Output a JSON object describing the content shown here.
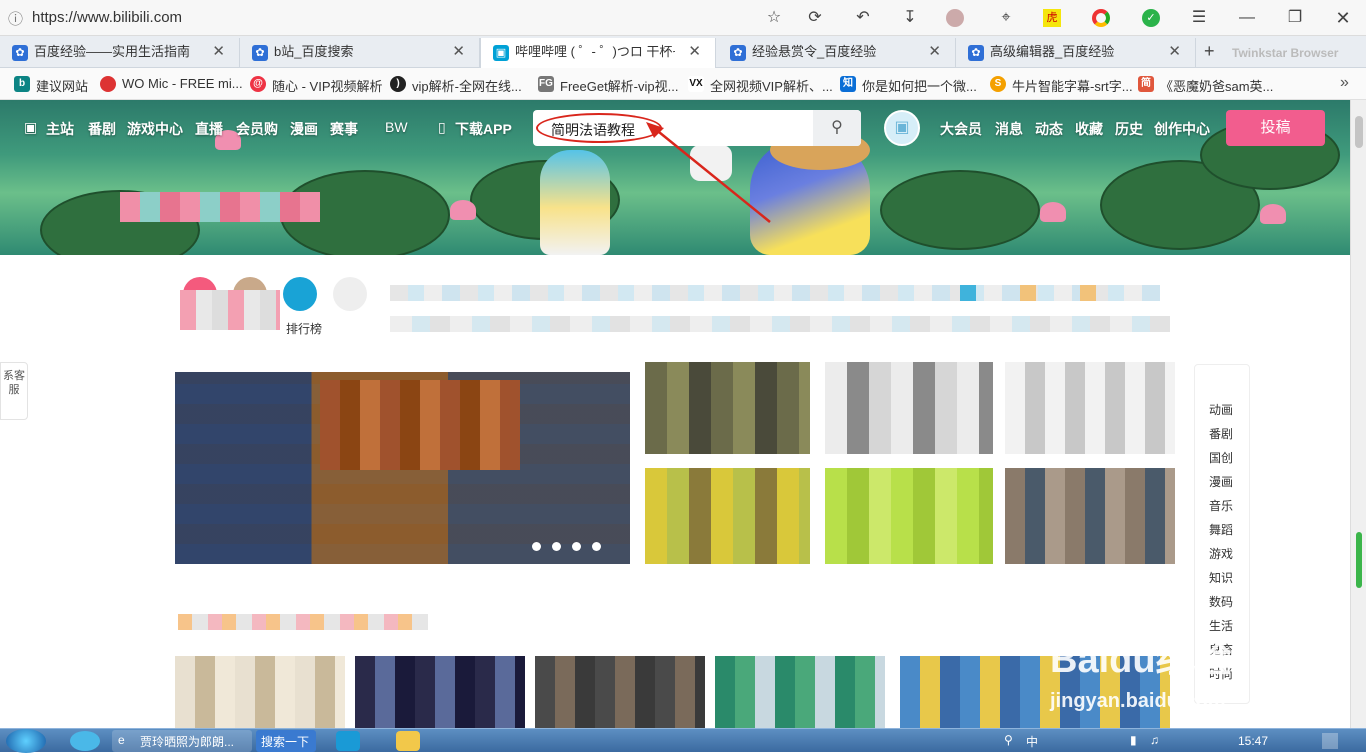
{
  "browser": {
    "url": "https://www.bilibili.com",
    "tabs": [
      {
        "label": "百度经验——实用生活指南",
        "icon": "baidu-paw-icon",
        "color": "#2f6fd6"
      },
      {
        "label": "b站_百度搜索",
        "icon": "baidu-paw-icon",
        "color": "#2f6fd6"
      },
      {
        "label": "哔哩哔哩 ( ゜- ゜)つロ 干杯~-b",
        "icon": "bilibili-tv-icon",
        "color": "#00a1d6"
      },
      {
        "label": "经验悬赏令_百度经验",
        "icon": "baidu-paw-icon",
        "color": "#2f6fd6"
      },
      {
        "label": "高级编辑器_百度经验",
        "icon": "baidu-paw-icon",
        "color": "#2f6fd6"
      }
    ],
    "new_tab_label": "Twinkstar Browser",
    "bookmarks": [
      {
        "label": "建议网站",
        "icon": "bing-icon",
        "color": "#0c8484"
      },
      {
        "label": "WO Mic - FREE mi...",
        "icon": "wo-mic-icon",
        "color": "#d33"
      },
      {
        "label": "随心 - VIP视频解析",
        "icon": "swirl-icon",
        "color": "#e34"
      },
      {
        "label": "vip解析-全网在线...",
        "icon": "moon-icon",
        "color": "#222"
      },
      {
        "label": "FreeGet解析-vip视...",
        "icon": "fg-icon",
        "color": "#666"
      },
      {
        "label": "全网视频VIP解析、...",
        "icon": "vx-icon",
        "color": "#111"
      },
      {
        "label": "你是如何把一个微...",
        "icon": "zhihu-icon",
        "color": "#0a6ed6"
      },
      {
        "label": "牛片智能字幕-srt字...",
        "icon": "niupian-icon",
        "color": "#f4a000"
      },
      {
        "label": "《恶魔奶爸sam英...",
        "icon": "jian-icon",
        "color": "#e0573c"
      }
    ]
  },
  "bilibili": {
    "nav_left": [
      "主站",
      "番剧",
      "游戏中心",
      "直播",
      "会员购",
      "漫画",
      "赛事",
      "BW",
      "下载APP"
    ],
    "search_value": "简明法语教程",
    "nav_right": [
      "大会员",
      "消息",
      "动态",
      "收藏",
      "历史",
      "创作中心"
    ],
    "post_button": "投稿",
    "rank_label": "排行榜",
    "left_float_label": "系客服",
    "right_nav": [
      "动画",
      "番剧",
      "国创",
      "漫画",
      "音乐",
      "舞蹈",
      "游戏",
      "知识",
      "数码",
      "生活",
      "鬼畜",
      "时尚"
    ]
  },
  "taskbar": {
    "items": [
      "贾玲晒照为郎朗...",
      "搜索一下"
    ],
    "lang": "中",
    "time": "15:47"
  },
  "watermark": {
    "logo": "Baidu经验",
    "site": "jingyan.baidu.com"
  }
}
